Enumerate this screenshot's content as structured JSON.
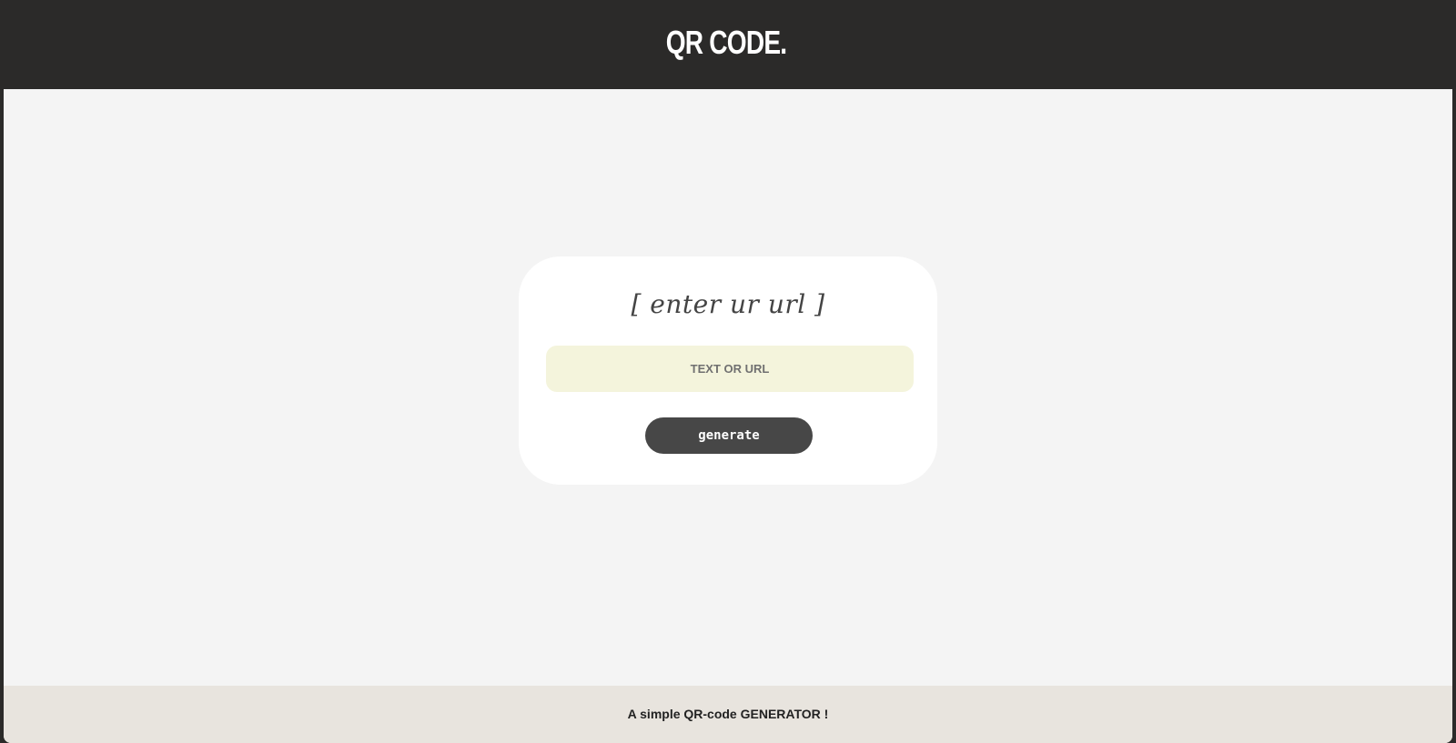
{
  "header": {
    "title": "QR CODE."
  },
  "card": {
    "heading": "[ enter ur url ]",
    "input": {
      "value": "",
      "placeholder": "TEXT OR URL"
    },
    "generate_label": "generate"
  },
  "footer": {
    "text": "A simple QR-code GENERATOR !"
  },
  "colors": {
    "header_bg": "#2b2a29",
    "page_bg": "#f4f4f4",
    "card_bg": "#ffffff",
    "input_bg": "#f4f4dc",
    "button_bg": "#474747",
    "footer_bg": "#e8e4de"
  }
}
